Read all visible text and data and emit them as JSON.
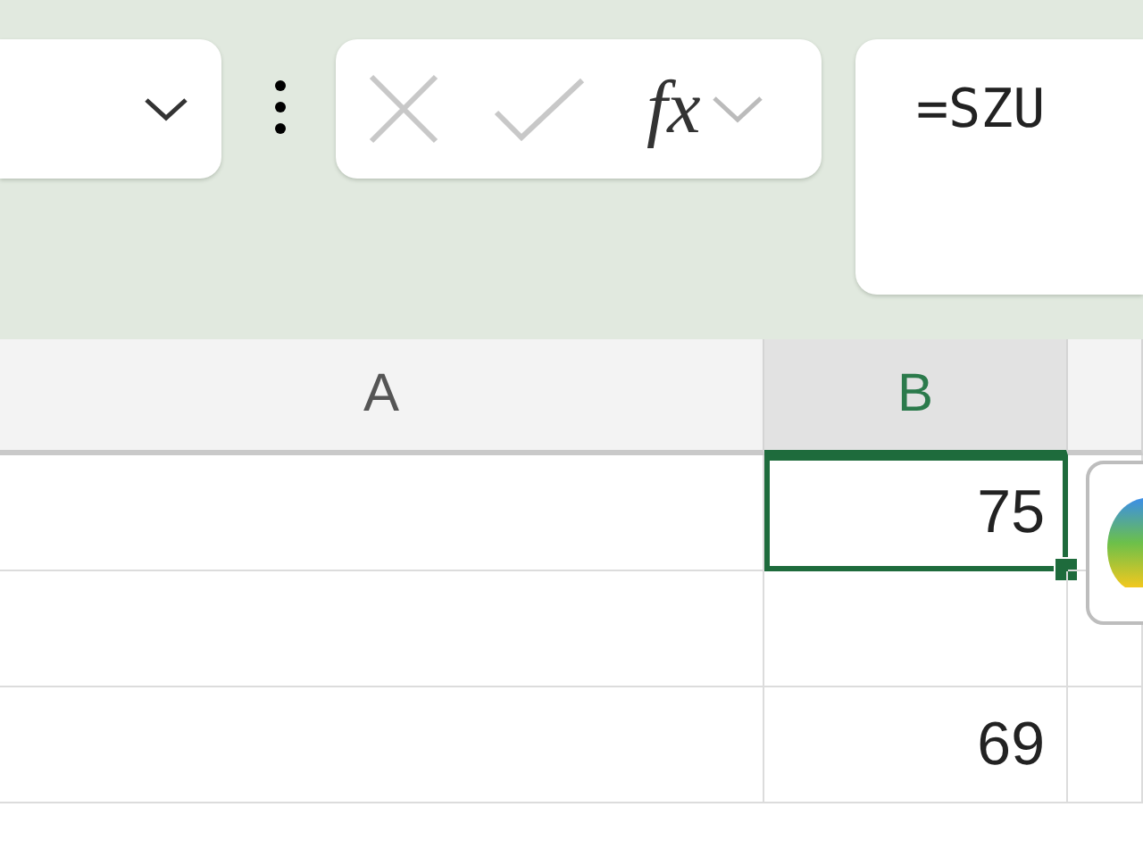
{
  "formula_bar": {
    "function_label": "fx",
    "formula": "=SZU"
  },
  "grid": {
    "columns": [
      {
        "label": "A",
        "selected": false
      },
      {
        "label": "B",
        "selected": true
      }
    ],
    "rows": [
      {
        "column_b": "75",
        "selected": true
      },
      {
        "selected": false
      },
      {
        "column_b": "69",
        "selected": false
      }
    ]
  }
}
